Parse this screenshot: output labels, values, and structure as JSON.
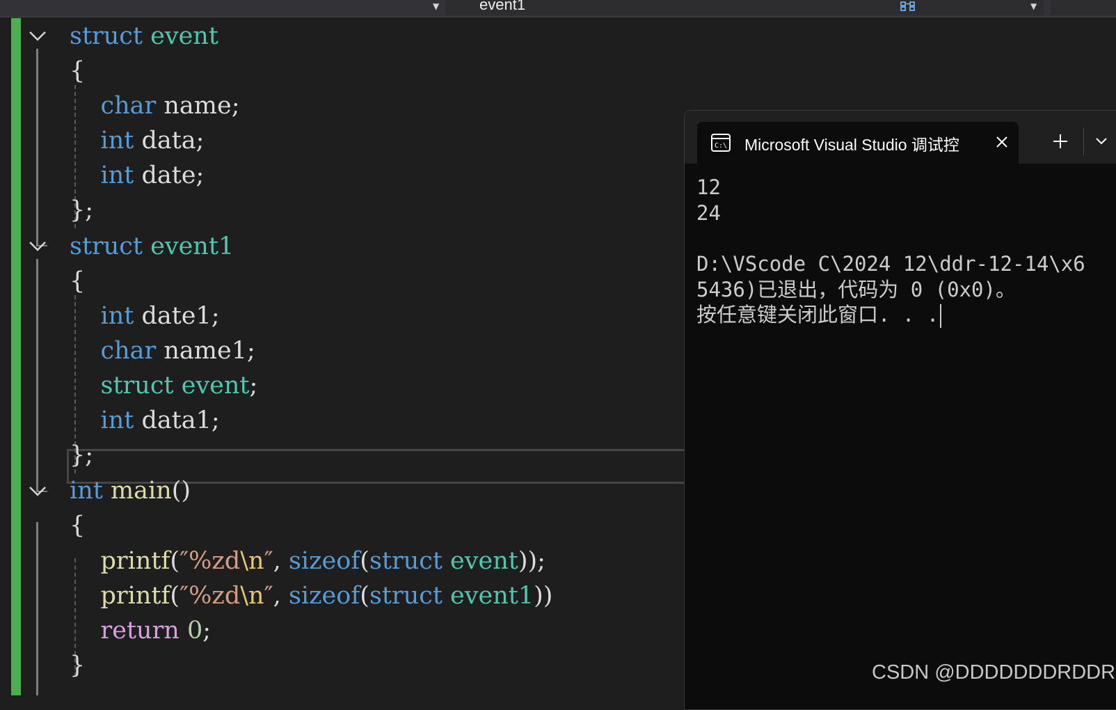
{
  "navigation_bar": {
    "member": "event1"
  },
  "editor": {
    "lines": [
      [
        {
          "t": "struct",
          "c": "kw"
        },
        {
          "t": " "
        },
        {
          "t": "event",
          "c": "ty"
        }
      ],
      [
        {
          "t": "{"
        }
      ],
      [
        {
          "t": "    "
        },
        {
          "t": "char",
          "c": "kw"
        },
        {
          "t": " name;"
        }
      ],
      [
        {
          "t": "    "
        },
        {
          "t": "int",
          "c": "kw"
        },
        {
          "t": " data;"
        }
      ],
      [
        {
          "t": "    "
        },
        {
          "t": "int",
          "c": "kw"
        },
        {
          "t": " date;"
        }
      ],
      [
        {
          "t": "};"
        }
      ],
      [
        {
          "t": "struct",
          "c": "kw"
        },
        {
          "t": " "
        },
        {
          "t": "event1",
          "c": "ty"
        }
      ],
      [
        {
          "t": "{"
        }
      ],
      [
        {
          "t": "    "
        },
        {
          "t": "int",
          "c": "kw"
        },
        {
          "t": " date1;"
        }
      ],
      [
        {
          "t": "    "
        },
        {
          "t": "char",
          "c": "kw"
        },
        {
          "t": " name1;"
        }
      ],
      [
        {
          "t": "    "
        },
        {
          "t": "struct",
          "c": "ty"
        },
        {
          "t": " "
        },
        {
          "t": "event",
          "c": "ty"
        },
        {
          "t": ";"
        }
      ],
      [
        {
          "t": "    "
        },
        {
          "t": "int",
          "c": "kw"
        },
        {
          "t": " data1;"
        }
      ],
      [
        {
          "t": "};"
        }
      ],
      [
        {
          "t": "int",
          "c": "kw"
        },
        {
          "t": " "
        },
        {
          "t": "main",
          "c": "fn"
        },
        {
          "t": "()"
        }
      ],
      [
        {
          "t": "{"
        }
      ],
      [
        {
          "t": "    "
        },
        {
          "t": "printf",
          "c": "fn"
        },
        {
          "t": "("
        },
        {
          "t": "″%zd",
          "c": "str"
        },
        {
          "t": "\\n",
          "c": "esc"
        },
        {
          "t": "″",
          "c": "str"
        },
        {
          "t": ", "
        },
        {
          "t": "sizeof",
          "c": "kw"
        },
        {
          "t": "("
        },
        {
          "t": "struct",
          "c": "kw"
        },
        {
          "t": " "
        },
        {
          "t": "event",
          "c": "ty"
        },
        {
          "t": "));"
        }
      ],
      [
        {
          "t": "    "
        },
        {
          "t": "printf",
          "c": "fn"
        },
        {
          "t": "("
        },
        {
          "t": "″%zd",
          "c": "str"
        },
        {
          "t": "\\n",
          "c": "esc"
        },
        {
          "t": "″",
          "c": "str"
        },
        {
          "t": ", "
        },
        {
          "t": "sizeof",
          "c": "kw"
        },
        {
          "t": "("
        },
        {
          "t": "struct",
          "c": "kw"
        },
        {
          "t": " "
        },
        {
          "t": "event1",
          "c": "ty"
        },
        {
          "t": "))"
        }
      ],
      [
        {
          "t": "    "
        },
        {
          "t": "return",
          "c": "ctl"
        },
        {
          "t": " "
        },
        {
          "t": "0",
          "c": "num"
        },
        {
          "t": ";"
        }
      ],
      [
        {
          "t": "}"
        }
      ]
    ]
  },
  "console": {
    "tab_title": "Microsoft Visual Studio 调试控",
    "output_lines": [
      "12",
      "24",
      "",
      "D:\\VScode C\\2024 12\\ddr-12-14\\x6",
      "5436)已退出，代码为 0 (0x0)。",
      "按任意键关闭此窗口. . ."
    ]
  },
  "watermark": "CSDN @DDDDDDDRDDR"
}
